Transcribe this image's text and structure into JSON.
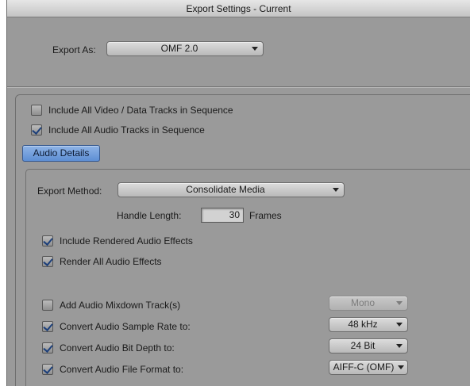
{
  "window": {
    "title": "Export Settings - Current"
  },
  "export_as": {
    "label": "Export As:",
    "value": "OMF 2.0"
  },
  "tracks": {
    "include_video": {
      "label": "Include All Video / Data Tracks in Sequence",
      "checked": false
    },
    "include_audio": {
      "label": "Include All Audio Tracks in Sequence",
      "checked": true
    }
  },
  "audio_details": {
    "tab_label": "Audio Details",
    "export_method": {
      "label": "Export Method:",
      "value": "Consolidate Media"
    },
    "handle_length": {
      "label": "Handle Length:",
      "value": "30",
      "unit": "Frames"
    },
    "include_rendered": {
      "label": "Include Rendered Audio Effects",
      "checked": true
    },
    "render_all": {
      "label": "Render All Audio Effects",
      "checked": true
    },
    "add_mixdown": {
      "label": "Add Audio Mixdown Track(s)",
      "checked": false,
      "value": "Mono"
    },
    "sample_rate": {
      "label": "Convert Audio Sample Rate to:",
      "checked": true,
      "value": "48 kHz"
    },
    "bit_depth": {
      "label": "Convert Audio Bit Depth to:",
      "checked": true,
      "value": "24 Bit"
    },
    "file_format": {
      "label": "Convert Audio File Format to:",
      "checked": true,
      "value": "AIFF-C (OMF)"
    }
  },
  "colors": {
    "panel": "#9a9a9a",
    "accent": "#5d8ed4"
  }
}
